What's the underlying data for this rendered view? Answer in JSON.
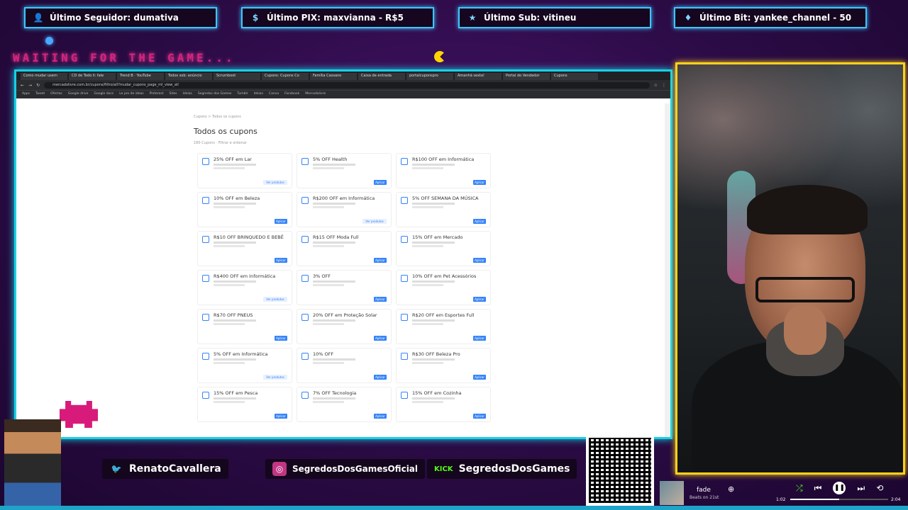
{
  "overlay": {
    "top_bars": [
      {
        "label": "Último Seguidor: dumativa",
        "icon": "user-icon"
      },
      {
        "label": "Último PIX: maxvianna - R$5",
        "icon": "dollar-icon"
      },
      {
        "label": "Último Sub: vitineu",
        "icon": "star-icon"
      },
      {
        "label": "Último Bit: yankee_channel - 50",
        "icon": "diamond-icon"
      }
    ],
    "waiting_text": "WAITING FOR THE GAME...",
    "accent_pink": "#d6237d",
    "accent_cyan": "#17d0e6",
    "accent_yellow": "#ffd21a"
  },
  "browser": {
    "tabs": [
      "Como mudar usern",
      "CD de Todo li: fale",
      "Trend B · YouTube",
      "Todos sob: anúncio",
      "Scrumboot",
      "Cupons: Cupons Co",
      "Família Cassano",
      "Caixa de entrada",
      "portalcuponspro",
      "Amanhã sexta!",
      "Portal do Vendedor",
      "Cupons"
    ],
    "url": "mercadolivre.com.br/cupons/filtro/all?mudar_cupons_page_ml_view_all",
    "bookmarks": [
      "Apps",
      "Tweet",
      "Ofertas",
      "Google drive",
      "Google docs",
      "Le pro de ideas",
      "Pinterest",
      "Sites",
      "Ideias",
      "Segredos dos Games",
      "Tumblr",
      "Ideias",
      "Canva",
      "Facebook",
      "Mercadolivre"
    ]
  },
  "page": {
    "breadcrumb": "Cupons  >  Todos os cupons",
    "title": "Todos os cupons",
    "count": "180 Cupons  ·  Filtrar e ordenar",
    "coupons": [
      {
        "title": "25% OFF em Lar",
        "button": "Ver produtos"
      },
      {
        "title": "5% OFF Health",
        "button": "Aplicar"
      },
      {
        "title": "R$100 OFF em Informática",
        "button": "Aplicar"
      },
      {
        "title": "10% OFF em Beleza",
        "button": "Aplicar"
      },
      {
        "title": "R$200 OFF em Informática",
        "button": "Ver produtos"
      },
      {
        "title": "5% OFF SEMANA DA MÚSICA",
        "button": "Aplicar"
      },
      {
        "title": "R$10 OFF BRINQUEDO E BEBÊ",
        "button": "Aplicar"
      },
      {
        "title": "R$15 OFF Moda Full",
        "button": "Aplicar"
      },
      {
        "title": "15% OFF em Mercado",
        "button": "Aplicar"
      },
      {
        "title": "R$400 OFF em Informática",
        "button": "Ver produtos"
      },
      {
        "title": "3% OFF",
        "button": "Aplicar"
      },
      {
        "title": "10% OFF em Pet Acessórios",
        "button": "Aplicar"
      },
      {
        "title": "R$70 OFF PNEUS",
        "button": "Aplicar"
      },
      {
        "title": "20% OFF em Proteção Solar",
        "button": "Aplicar"
      },
      {
        "title": "R$20 OFF em Esportes Full",
        "button": "Aplicar"
      },
      {
        "title": "5% OFF em Informática",
        "button": "Ver produtos"
      },
      {
        "title": "10% OFF",
        "button": "Aplicar"
      },
      {
        "title": "R$30 OFF Beleza Pro",
        "button": "Aplicar"
      },
      {
        "title": "15% OFF em Pesca",
        "button": "Aplicar"
      },
      {
        "title": "7% OFF Tecnologia",
        "button": "Aplicar"
      },
      {
        "title": "15% OFF em Cozinha",
        "button": "Aplicar"
      }
    ]
  },
  "social": {
    "twitter": "RenatoCavallera",
    "instagram": "SegredosDosGamesOficial",
    "kick_label": "KICK",
    "kick": "SegredosDosGames",
    "livepix": "livepix.gg/segredosdosgames"
  },
  "player": {
    "song": "fade",
    "artist": "Beats on 21st",
    "time_current": "1:02",
    "time_total": "2:04",
    "progress": 0.5
  }
}
